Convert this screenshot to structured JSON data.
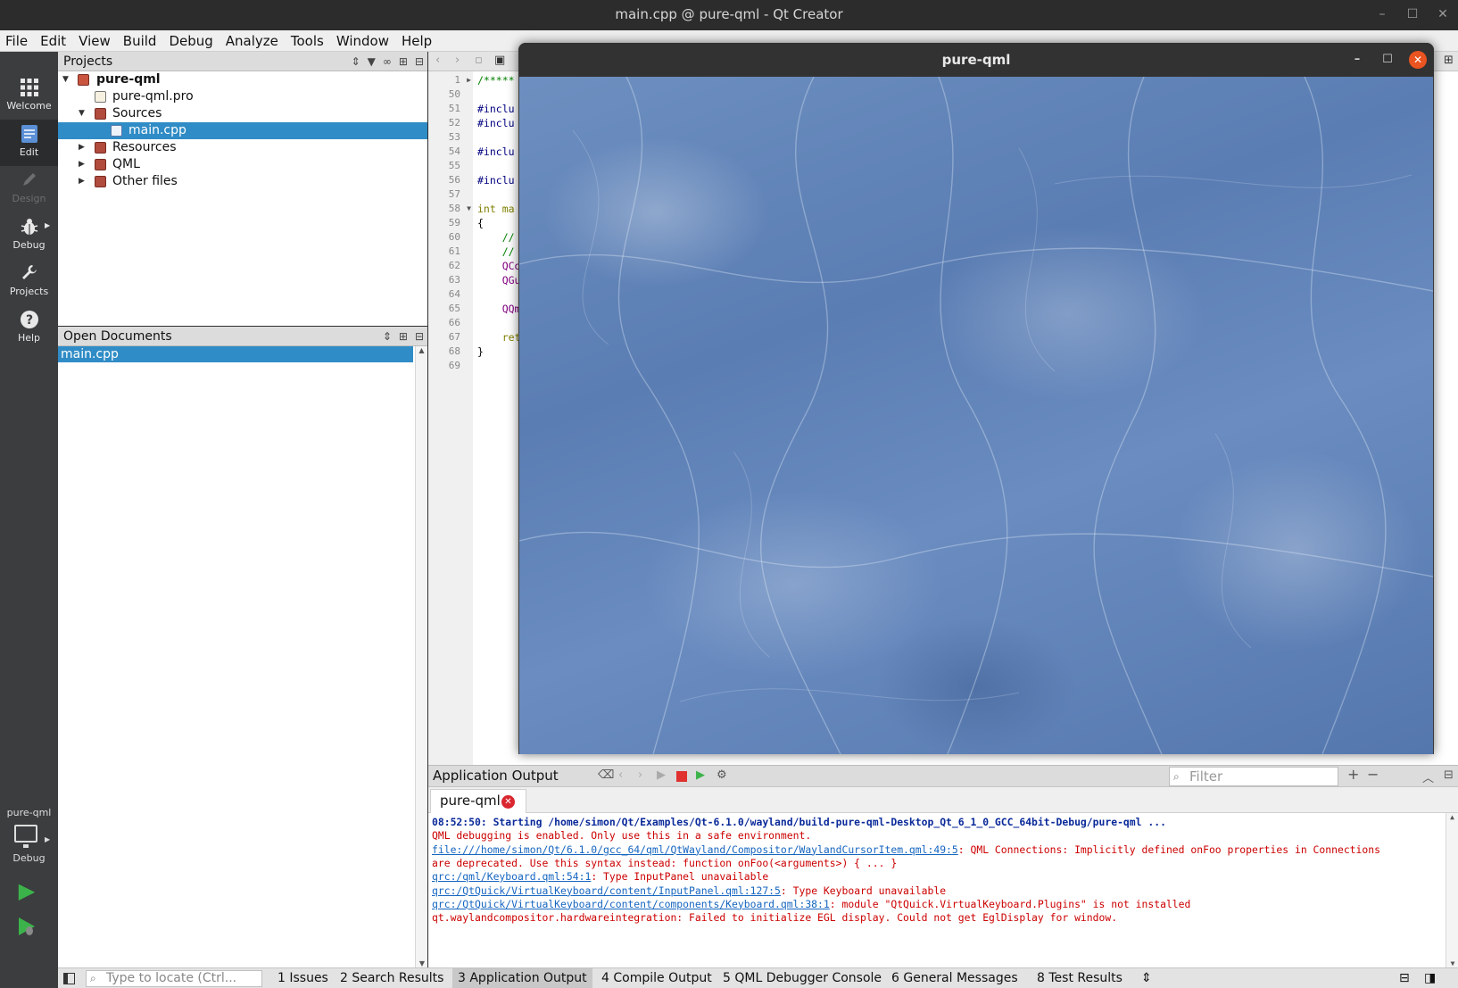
{
  "window": {
    "title": "main.cpp @ pure-qml - Qt Creator",
    "controls": [
      "–",
      "☐",
      "✕"
    ]
  },
  "menu": [
    "File",
    "Edit",
    "View",
    "Build",
    "Debug",
    "Analyze",
    "Tools",
    "Window",
    "Help"
  ],
  "modes": [
    {
      "label": "Welcome",
      "icon": "grid-icon"
    },
    {
      "label": "Edit",
      "icon": "document-icon"
    },
    {
      "label": "Design",
      "icon": "pen-icon"
    },
    {
      "label": "Debug",
      "icon": "bug-icon"
    },
    {
      "label": "Projects",
      "icon": "wrench-icon"
    },
    {
      "label": "Help",
      "icon": "question-icon"
    }
  ],
  "kit": {
    "project": "pure-qml",
    "mode": "Debug"
  },
  "projects_panel": {
    "title": "Projects",
    "tree": [
      {
        "label": "pure-qml",
        "bold": true
      },
      {
        "label": "pure-qml.pro"
      },
      {
        "label": "Sources"
      },
      {
        "label": "main.cpp",
        "selected": true
      },
      {
        "label": "Resources"
      },
      {
        "label": "QML"
      },
      {
        "label": "Other files"
      }
    ]
  },
  "open_documents": {
    "title": "Open Documents",
    "items": [
      "main.cpp"
    ]
  },
  "editor": {
    "lines": [
      {
        "num": "1",
        "text": "/*****"
      },
      {
        "num": "50",
        "text": ""
      },
      {
        "num": "51",
        "text": "#inclu"
      },
      {
        "num": "52",
        "text": "#inclu"
      },
      {
        "num": "53",
        "text": ""
      },
      {
        "num": "54",
        "text": "#inclu"
      },
      {
        "num": "55",
        "text": ""
      },
      {
        "num": "56",
        "text": "#inclu"
      },
      {
        "num": "57",
        "text": ""
      },
      {
        "num": "58",
        "text": "int ma"
      },
      {
        "num": "59",
        "text": "{"
      },
      {
        "num": "60",
        "text": "    //"
      },
      {
        "num": "61",
        "text": "    //"
      },
      {
        "num": "62",
        "text": "    QCo"
      },
      {
        "num": "63",
        "text": "    QGu"
      },
      {
        "num": "64",
        "text": ""
      },
      {
        "num": "65",
        "text": "    QQm"
      },
      {
        "num": "66",
        "text": ""
      },
      {
        "num": "67",
        "text": "    ret"
      },
      {
        "num": "68",
        "text": "}"
      },
      {
        "num": "69",
        "text": ""
      }
    ]
  },
  "qml_window": {
    "title": "pure-qml"
  },
  "output": {
    "title": "Application Output",
    "filter_placeholder": "Filter",
    "tab": "pure-qml",
    "lines": [
      {
        "kind": "info",
        "text": "08:52:50: Starting /home/simon/Qt/Examples/Qt-6.1.0/wayland/build-pure-qml-Desktop_Qt_6_1_0_GCC_64bit-Debug/pure-qml ..."
      },
      {
        "kind": "error",
        "text": "QML debugging is enabled. Only use this in a safe environment."
      },
      {
        "kind": "error",
        "link": "file:///home/simon/Qt/6.1.0/gcc_64/qml/QtWayland/Compositor/WaylandCursorItem.qml:49:5",
        "text": ": QML Connections: Implicitly defined onFoo properties in Connections"
      },
      {
        "kind": "error",
        "text": "are deprecated. Use this syntax instead: function onFoo(<arguments>) { ... }"
      },
      {
        "kind": "error",
        "link": "qrc:/qml/Keyboard.qml:54:1",
        "text": ": Type InputPanel unavailable"
      },
      {
        "kind": "error",
        "link": "qrc:/QtQuick/VirtualKeyboard/content/InputPanel.qml:127:5",
        "text": ": Type Keyboard unavailable"
      },
      {
        "kind": "error",
        "link": "qrc:/QtQuick/VirtualKeyboard/content/components/Keyboard.qml:38:1",
        "text": ": module \"QtQuick.VirtualKeyboard.Plugins\" is not installed"
      },
      {
        "kind": "error",
        "text": "qt.waylandcompositor.hardwareintegration: Failed to initialize EGL display. Could not get EglDisplay for window."
      }
    ]
  },
  "statusbar": {
    "locator_placeholder": "Type to locate (Ctrl...",
    "buttons": [
      "1  Issues",
      "2  Search Results",
      "3  Application Output",
      "4  Compile Output",
      "5  QML Debugger Console",
      "6  General Messages",
      "8  Test Results"
    ]
  }
}
